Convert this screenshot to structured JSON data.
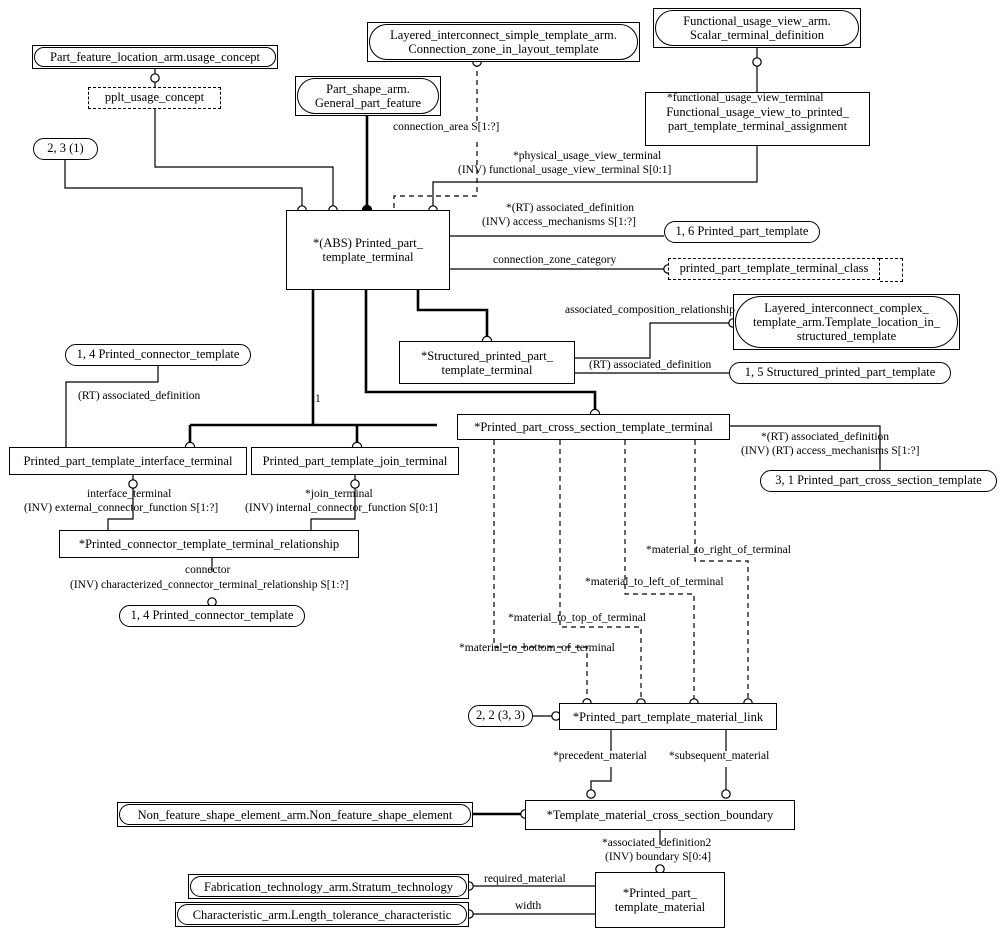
{
  "diagram": {
    "title": "Printed part template terminal EXPRESS-G diagram",
    "type": "express-g-entity-level-diagram"
  },
  "nodes": {
    "part_feature_location": {
      "label": "Part_feature_location_arm.usage_concept",
      "kind": "schema-reference"
    },
    "pplt_usage_concept": {
      "label": "pplt_usage_concept",
      "kind": "select-type"
    },
    "page_ref_2_3_1": {
      "label": "2, 3 (1)",
      "kind": "page-reference"
    },
    "part_shape_arm": {
      "label": "Part_shape_arm.\nGeneral_part_feature",
      "line1": "Part_shape_arm.",
      "line2": "General_part_feature",
      "kind": "schema-reference"
    },
    "layered_simple": {
      "line1": "Layered_interconnect_simple_template_arm.",
      "line2": "Connection_zone_in_layout_template",
      "kind": "schema-reference"
    },
    "functional_usage_view_arm": {
      "line1": "Functional_usage_view_arm.",
      "line2": "Scalar_terminal_definition",
      "kind": "schema-reference"
    },
    "fuv_to_ppt_assignment": {
      "line1": "Functional_usage_view_to_printed_",
      "line2": "part_template_terminal_assignment",
      "kind": "entity"
    },
    "printed_part_template_terminal": {
      "line1": "*(ABS) Printed_part_",
      "line2": "template_terminal",
      "kind": "entity"
    },
    "page_ref_1_6": {
      "label": "1, 6 Printed_part_template",
      "kind": "page-reference"
    },
    "pptt_class": {
      "label": "printed_part_template_terminal_class",
      "kind": "select-type"
    },
    "layered_complex": {
      "line1": "Layered_interconnect_complex_",
      "line2": "template_arm.Template_location_in_",
      "line3": "structured_template",
      "kind": "schema-reference"
    },
    "structured_pptt": {
      "line1": "*Structured_printed_part_",
      "line2": "template_terminal",
      "kind": "entity"
    },
    "page_ref_1_5": {
      "label": "1, 5 Structured_printed_part_template",
      "kind": "page-reference"
    },
    "page_ref_1_4_top": {
      "label": "1, 4 Printed_connector_template",
      "kind": "page-reference"
    },
    "interface_terminal_box": {
      "label": "Printed_part_template_interface_terminal",
      "kind": "entity"
    },
    "join_terminal_box": {
      "label": "Printed_part_template_join_terminal",
      "kind": "entity"
    },
    "pct_terminal_relationship": {
      "label": "*Printed_connector_template_terminal_relationship",
      "kind": "entity"
    },
    "page_ref_1_4_bottom": {
      "label": "1, 4 Printed_connector_template",
      "kind": "page-reference"
    },
    "cross_section_terminal": {
      "label": "*Printed_part_cross_section_template_terminal",
      "kind": "entity"
    },
    "page_ref_3_1": {
      "label": "3, 1 Printed_part_cross_section_template",
      "kind": "page-reference"
    },
    "page_ref_2_2_3_3": {
      "label": "2, 2 (3, 3)",
      "kind": "page-reference"
    },
    "material_link": {
      "label": "*Printed_part_template_material_link",
      "kind": "entity"
    },
    "non_feature_shape_element": {
      "label": "Non_feature_shape_element_arm.Non_feature_shape_element",
      "kind": "schema-reference"
    },
    "template_material_boundary": {
      "label": "*Template_material_cross_section_boundary",
      "kind": "entity"
    },
    "fabrication_technology": {
      "label": "Fabrication_technology_arm.Stratum_technology",
      "kind": "schema-reference"
    },
    "characteristic_arm": {
      "label": "Characteristic_arm.Length_tolerance_characteristic",
      "kind": "schema-reference"
    },
    "printed_part_template_material": {
      "line1": "*Printed_part_",
      "line2": "template_material",
      "kind": "entity"
    }
  },
  "edge_labels": {
    "connection_area": "connection_area S[1:?]",
    "functional_usage_view_terminal": "*functional_usage_view_terminal",
    "physical_usage_view_terminal_l1": "*physical_usage_view_terminal",
    "physical_usage_view_terminal_l2": "(INV) functional_usage_view_terminal S[0:1]",
    "rt_associated_definition_l1": "*(RT) associated_definition",
    "rt_associated_definition_l2": "(INV) access_mechanisms S[1:?]",
    "connection_zone_category": "connection_zone_category",
    "associated_composition_relationship": "associated_composition_relationship",
    "rt_associated_definition_struct": "(RT) associated_definition",
    "rt_associated_definition_conn": "(RT) associated_definition",
    "one": "1",
    "interface_terminal_l1": "interface_terminal",
    "interface_terminal_l2": "(INV) external_connector_function S[1:?]",
    "join_terminal_l1": "*join_terminal",
    "join_terminal_l2": "(INV) internal_connector_function S[0:1]",
    "connector_l1": "connector",
    "connector_l2": "(INV) characterized_connector_terminal_relationship S[1:?]",
    "cs_rt_associated_definition_l1": "*(RT) associated_definition",
    "cs_rt_associated_definition_l2": "(INV) (RT) access_mechanisms S[1:?]",
    "material_to_right": "*material_to_right_of_terminal",
    "material_to_left": "*material_to_left_of_terminal",
    "material_to_top": "*material_to_top_of_terminal",
    "material_to_bottom": "*material_to_bottom_of_terminal",
    "precedent_material": "*precedent_material",
    "subsequent_material": "*subsequent_material",
    "associated_definition2_l1": "*associated_definition2",
    "associated_definition2_l2": "(INV) boundary S[0:4]",
    "required_material": "required_material",
    "width": "width"
  },
  "colors": {
    "stroke": "#000000",
    "background": "#ffffff",
    "text": "#000000"
  }
}
